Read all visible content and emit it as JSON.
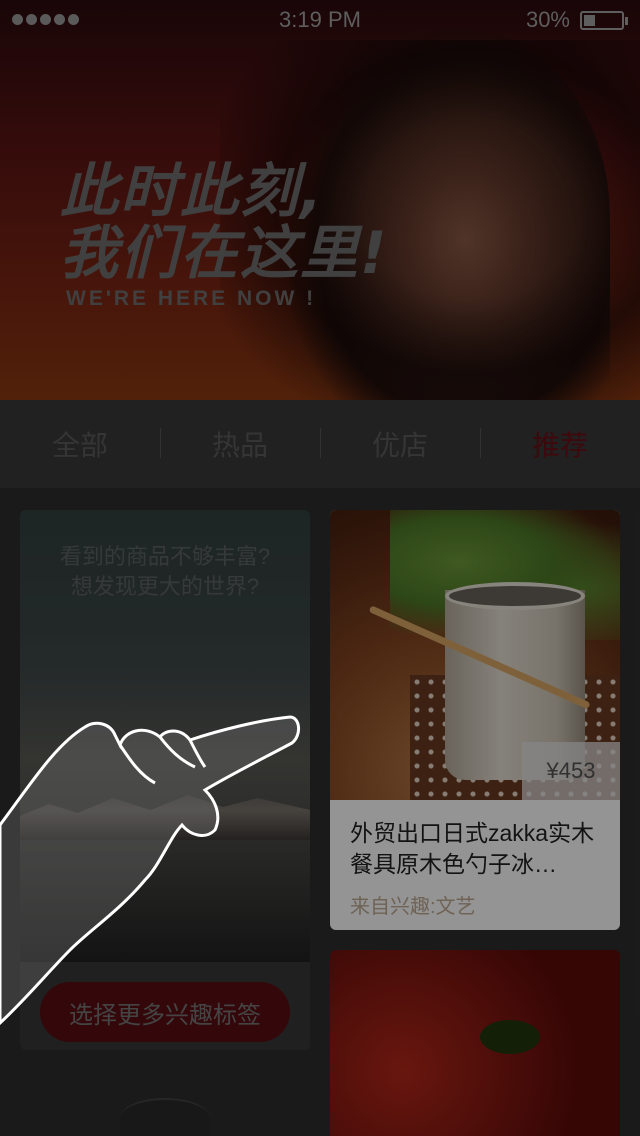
{
  "status_bar": {
    "time": "3:19 PM",
    "battery_percent": "30%",
    "battery_level": 0.3
  },
  "hero": {
    "title_line1": "此时此刻,",
    "title_line2": "我们在这里!",
    "subtitle": "WE'RE HERE NOW !"
  },
  "tabs": [
    {
      "label": "全部",
      "active": false
    },
    {
      "label": "热品",
      "active": false
    },
    {
      "label": "优店",
      "active": false
    },
    {
      "label": "推荐",
      "active": true
    }
  ],
  "discover_card": {
    "line1": "看到的商品不够丰富?",
    "line2": "想发现更大的世界?",
    "button_label": "选择更多兴趣标签"
  },
  "product": {
    "price": "¥453",
    "title": "外贸出口日式zakka实木餐具原木色勺子冰…",
    "from": "来自兴趣:文艺"
  },
  "colors": {
    "accent": "#6b1116",
    "button": "#5a0d12",
    "from_text": "#c0ab94"
  },
  "icons": [
    "signal-icon",
    "battery-icon",
    "hand-gesture-icon"
  ]
}
